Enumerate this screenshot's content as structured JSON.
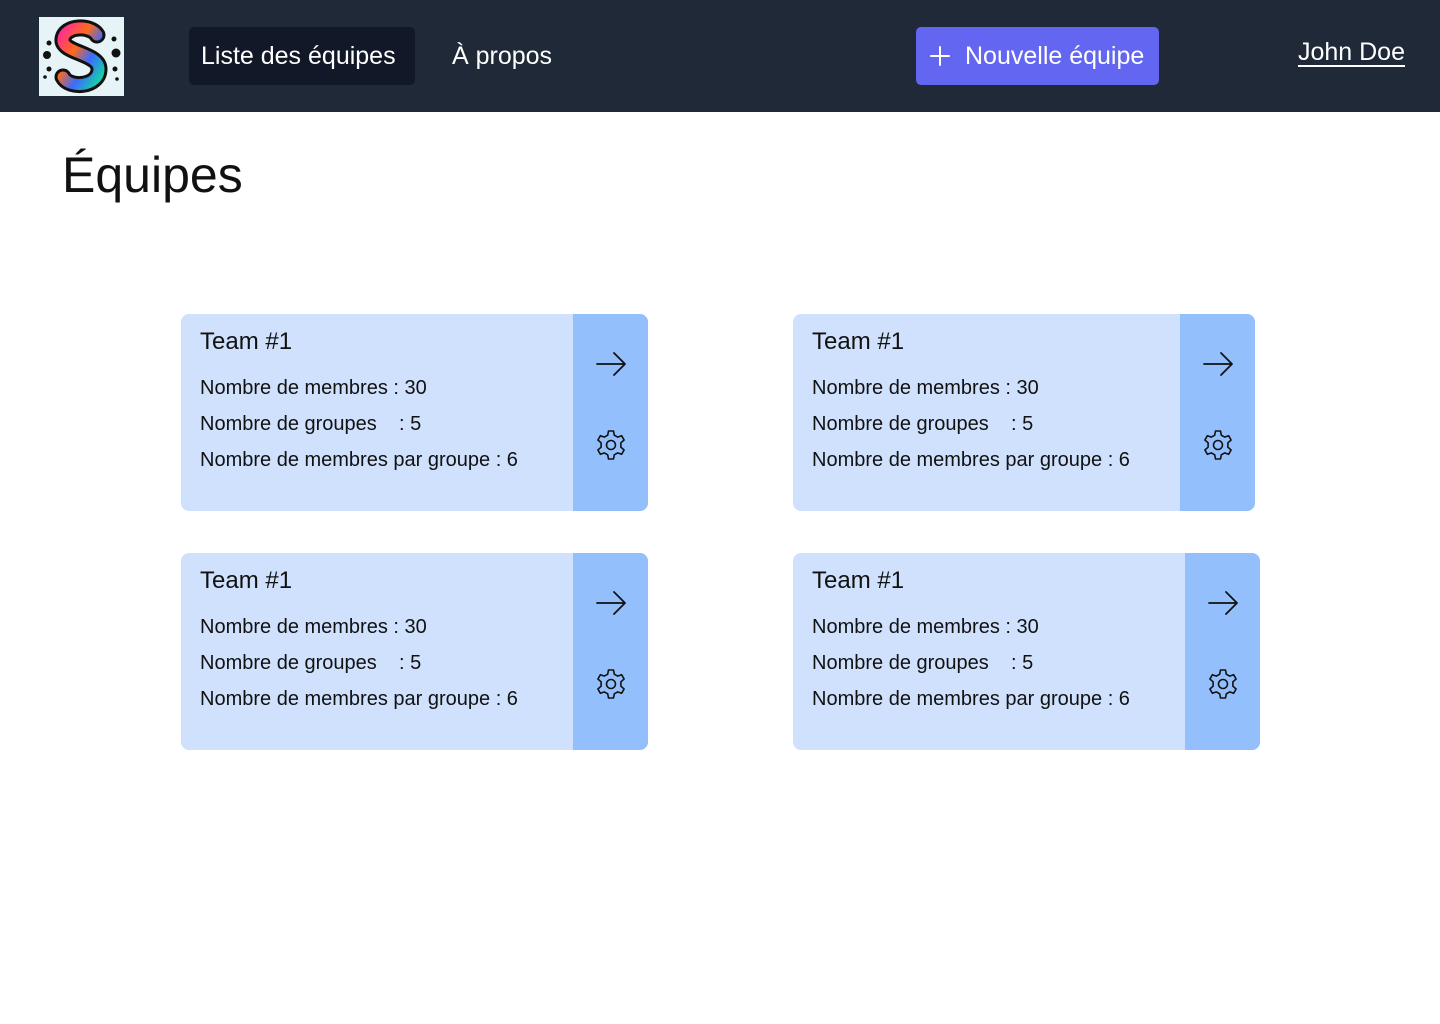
{
  "header": {
    "logo": "app-logo-s",
    "nav": [
      {
        "label": "Liste des équipes",
        "active": true
      },
      {
        "label": "À propos",
        "active": false
      }
    ],
    "new_team_label": "Nouvelle équipe",
    "user_name": "John Doe"
  },
  "main": {
    "title": "Équipes",
    "teams": [
      {
        "name": "Team #1",
        "members": "Nombre de membres : 30",
        "groups": "Nombre de groupes    : 5",
        "per_group": "Nombre de membres par groupe : 6"
      },
      {
        "name": "Team #1",
        "members": "Nombre de membres : 30",
        "groups": "Nombre de groupes    : 5",
        "per_group": "Nombre de membres par groupe : 6"
      },
      {
        "name": "Team #1",
        "members": "Nombre de membres : 30",
        "groups": "Nombre de groupes    : 5",
        "per_group": "Nombre de membres par groupe : 6"
      },
      {
        "name": "Team #1",
        "members": "Nombre de membres : 30",
        "groups": "Nombre de groupes    : 5",
        "per_group": "Nombre de membres par groupe : 6"
      }
    ]
  },
  "icons": {
    "open": "arrow-right-icon",
    "settings": "gear-icon",
    "add": "plus-icon"
  },
  "colors": {
    "topbar": "#1f2937",
    "nav_active": "#111827",
    "primary_button": "#6366f1",
    "card_background": "#cfe1fc",
    "card_actions": "#93c0fd"
  }
}
